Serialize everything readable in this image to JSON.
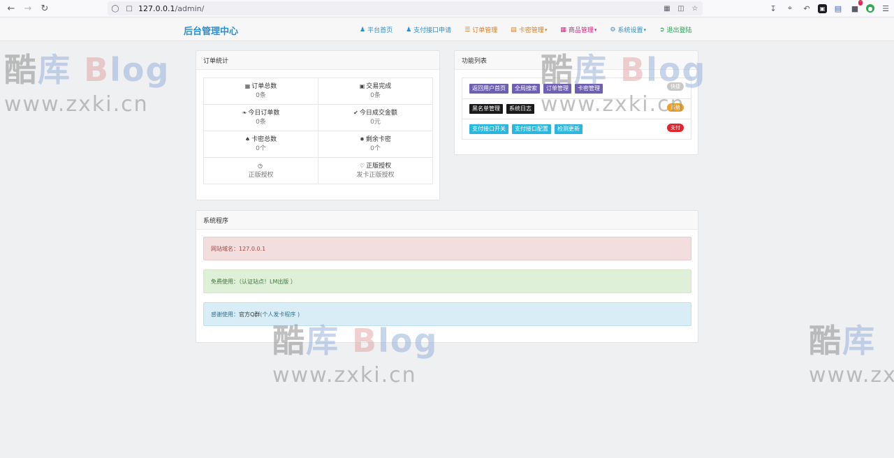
{
  "browser": {
    "url_host": "127.0.0.1",
    "url_path": "/admin/"
  },
  "navbar": {
    "brand": "后台管理中心",
    "items": [
      {
        "label": "平台首页",
        "icon": "user-icon"
      },
      {
        "label": "支付接口申请",
        "icon": "user-icon"
      },
      {
        "label": "订单管理",
        "icon": "list-icon"
      },
      {
        "label": "卡密管理",
        "icon": "book-icon",
        "dropdown": true
      },
      {
        "label": "商品管理",
        "icon": "list-alt-icon",
        "dropdown": true
      },
      {
        "label": "系统设置",
        "icon": "gear-icon",
        "dropdown": true
      },
      {
        "label": "退出登陆",
        "icon": "logout-icon"
      }
    ]
  },
  "stats": {
    "title": "订单统计",
    "cells": [
      {
        "label": "订单总数",
        "value": "0条",
        "icon": "grid-icon"
      },
      {
        "label": "交易完成",
        "value": "0条",
        "icon": "cart-icon"
      },
      {
        "label": "今日订单数",
        "value": "0条",
        "icon": "leaf-icon"
      },
      {
        "label": "今日成交金额",
        "value": "0元",
        "icon": "check-icon"
      },
      {
        "label": "卡密总数",
        "value": "0个",
        "icon": "tree-icon"
      },
      {
        "label": "剩余卡密",
        "value": "0个",
        "icon": "asterisk-icon"
      },
      {
        "label": "",
        "value": "正版授权",
        "icon": "clock-icon"
      },
      {
        "label": "正版授权",
        "value": "发卡正版授权",
        "icon": "heart-icon"
      }
    ]
  },
  "functions": {
    "title": "功能列表",
    "rows": [
      {
        "buttons": [
          "返回用户首页",
          "全局搜索",
          "订单管理",
          "卡密管理"
        ],
        "badge": "快捷"
      },
      {
        "buttons": [
          "黑名单管理",
          "系统日志"
        ],
        "badge": "系统"
      },
      {
        "buttons": [
          "支付接口开关",
          "支付接口配置",
          "检测更新"
        ],
        "badge": "支付"
      }
    ]
  },
  "system": {
    "title": "系统程序",
    "domain_label": "网站域名：",
    "domain_value": "127.0.0.1",
    "free_text": "免费使用：（认证站点！LM出版 ）",
    "thanks_label": "感谢使用：",
    "thanks_strong": "官方Q群",
    "thanks_rest": " (个人发卡程序 )"
  },
  "watermark": {
    "line1_a": "酷",
    "line1_b": "库",
    "line1_c": "B",
    "line1_d": "log",
    "line2": "www.zxki.cn"
  },
  "colors": {
    "brand": "#2a8fd1",
    "purple": "#6f5fb2",
    "cyan": "#2bb6dd"
  }
}
